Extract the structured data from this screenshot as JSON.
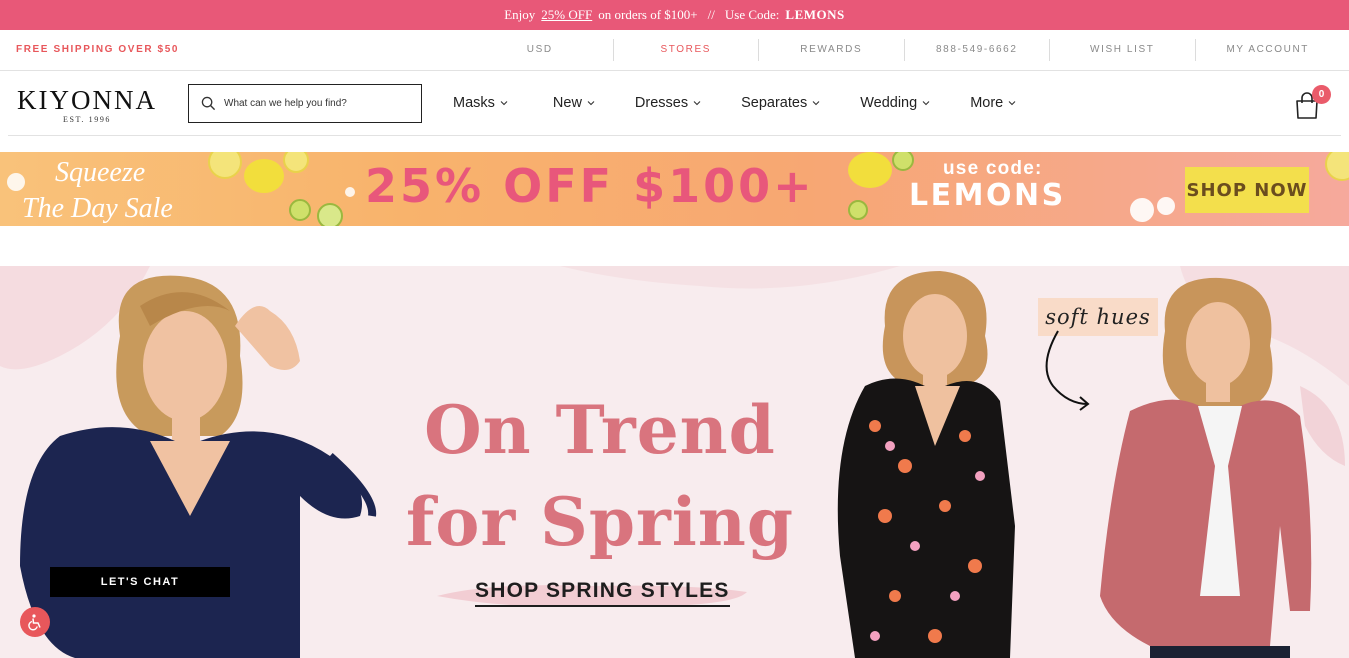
{
  "promo": {
    "prefix": "Enjoy",
    "offer": "25% OFF",
    "suffix": "on orders of $100+",
    "separator": "//",
    "code_label": "Use Code:",
    "code": "LEMONS"
  },
  "utility": {
    "shipping": "FREE SHIPPING OVER $50",
    "links": [
      "USD",
      "STORES",
      "REWARDS",
      "888-549-6662",
      "WISH LIST",
      "MY ACCOUNT"
    ]
  },
  "header": {
    "logo": "KIYONNA",
    "logo_sub": "EST. 1996",
    "search_placeholder": "What can we help you find?",
    "menu": [
      "Masks",
      "New",
      "Dresses",
      "Separates",
      "Wedding",
      "More"
    ],
    "cart_count": "0"
  },
  "sale_banner": {
    "line1": "Squeeze",
    "line2": "The Day Sale",
    "offer": "25% OFF $100+",
    "use_code": "use code:",
    "code": "LEMONS",
    "cta": "SHOP NOW"
  },
  "hero": {
    "headline_1": "On Trend",
    "headline_2": "for Spring",
    "cta": "SHOP SPRING STYLES",
    "tag": "soft hues"
  },
  "chat_label": "LET'S CHAT",
  "colors": {
    "brand_pink": "#e85878",
    "accent_red": "#e8575b",
    "headline": "#d9747e",
    "shop_now_bg": "#f3df4c"
  }
}
